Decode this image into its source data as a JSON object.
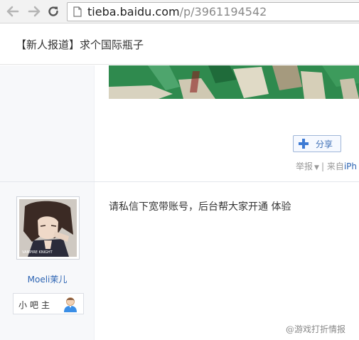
{
  "browser": {
    "url_host": "tieba.baidu.com",
    "url_path": "/p/3961194542",
    "icons": {
      "back": "back-arrow-icon",
      "forward": "forward-arrow-icon",
      "reload": "reload-icon",
      "page": "page-icon"
    }
  },
  "thread": {
    "title": "【新人报道】求个国际瓶子"
  },
  "first_post": {
    "share_label": "分享",
    "report_label": "举报",
    "separator": "|",
    "source_prefix": "来自",
    "source_link": "iPh"
  },
  "second_post": {
    "username": "Moeli茉儿",
    "badge_label": "小吧主",
    "content": "请私信下宽带账号，后台帮大家开通 体验",
    "avatar_caption": "VAMPIRE KNIGHT"
  },
  "watermark": "@游戏打折情报",
  "colors": {
    "link": "#2d64b3",
    "accent_green": "#2f8a4e",
    "badge_icon_blue": "#3a8ee6"
  }
}
